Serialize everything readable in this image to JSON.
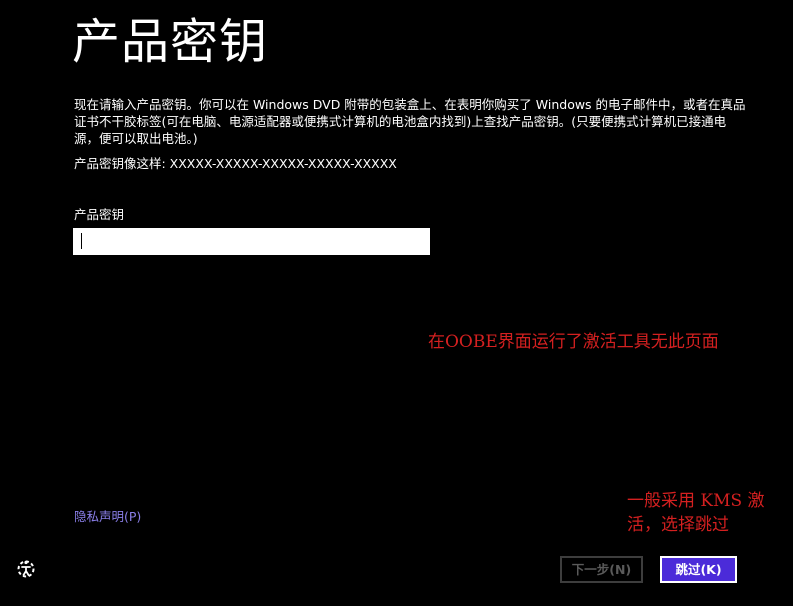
{
  "header": {
    "title": "产品密钥"
  },
  "main": {
    "description": "现在请输入产品密钥。你可以在 Windows DVD 附带的包装盒上、在表明你购买了 Windows 的电子邮件中，或者在真品证书不干胶标签(可在电脑、电源适配器或便携式计算机的电池盒内找到)上查找产品密钥。(只要便携式计算机已接通电源，便可以取出电池。)",
    "example": "产品密钥像这样: XXXXX-XXXXX-XXXXX-XXXXX-XXXXX",
    "field_label": "产品密钥",
    "key_value": ""
  },
  "annotations": {
    "note1": "在OOBE界面运行了激活工具无此页面",
    "note2": "一般采用 KMS 激活，选择跳过",
    "color": "#d42020"
  },
  "footer": {
    "privacy_link": "隐私声明(P)",
    "next_label": "下一步(N)",
    "skip_label": "跳过(K)",
    "accessibility_icon": "ease-of-access-icon"
  },
  "colors": {
    "background": "#000000",
    "accent": "#4b2bd9",
    "link": "#8a7fe8",
    "disabled_text": "#5a5a5a"
  }
}
